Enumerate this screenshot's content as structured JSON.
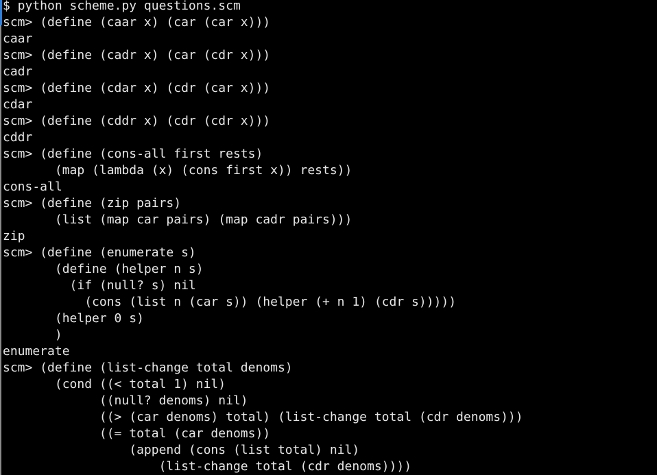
{
  "terminal": {
    "lines": [
      "$ python scheme.py questions.scm",
      "scm> (define (caar x) (car (car x)))",
      "caar",
      "scm> (define (cadr x) (car (cdr x)))",
      "cadr",
      "scm> (define (cdar x) (cdr (car x)))",
      "cdar",
      "scm> (define (cddr x) (cdr (cdr x)))",
      "cddr",
      "scm> (define (cons-all first rests)",
      "       (map (lambda (x) (cons first x)) rests))",
      "cons-all",
      "scm> (define (zip pairs)",
      "       (list (map car pairs) (map cadr pairs)))",
      "zip",
      "scm> (define (enumerate s)",
      "       (define (helper n s)",
      "         (if (null? s) nil",
      "           (cons (list n (car s)) (helper (+ n 1) (cdr s)))))",
      "       (helper 0 s)",
      "       )",
      "enumerate",
      "scm> (define (list-change total denoms)",
      "       (cond ((< total 1) nil)",
      "             ((null? denoms) nil)",
      "             ((> (car denoms) total) (list-change total (cdr denoms)))",
      "             ((= total (car denoms))",
      "                 (append (cons (list total) nil)",
      "                     (list-change total (cdr denoms))))"
    ]
  },
  "colors": {
    "background": "#000000",
    "text": "#e6e6e6",
    "accent": "#2f7fd8"
  }
}
